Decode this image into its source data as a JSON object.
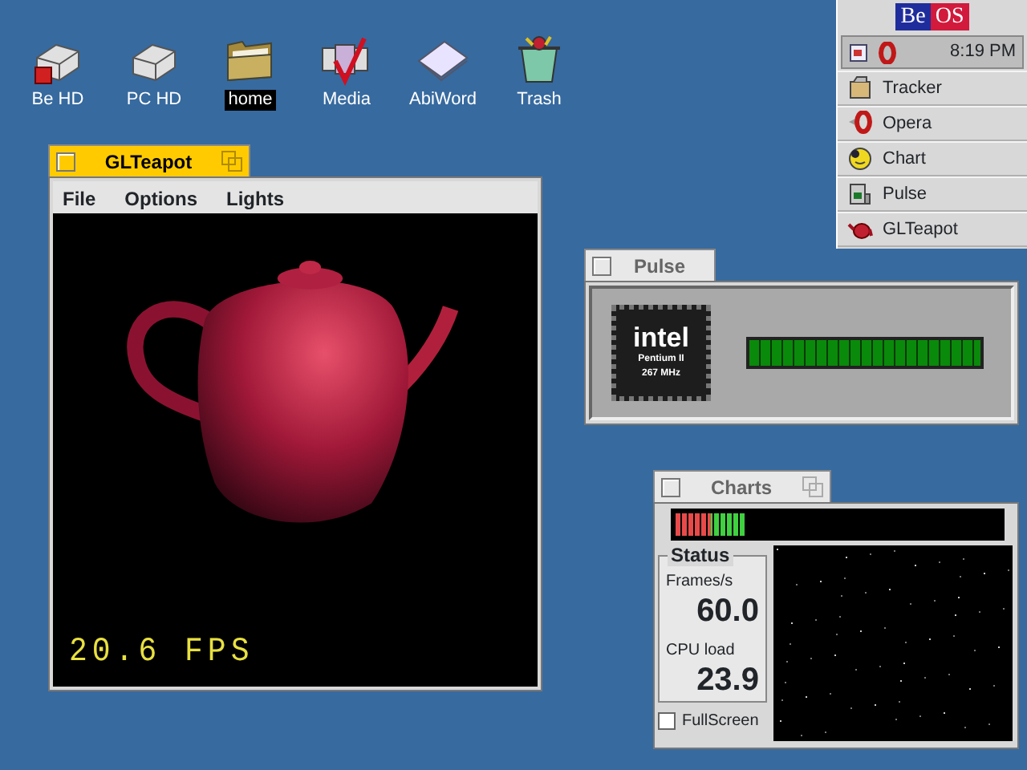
{
  "desktop_icons": [
    {
      "label": "Be HD",
      "kind": "boot-disk",
      "selected": false
    },
    {
      "label": "PC HD",
      "kind": "disk",
      "selected": false
    },
    {
      "label": "home",
      "kind": "folder",
      "selected": true
    },
    {
      "label": "Media",
      "kind": "media",
      "selected": false
    },
    {
      "label": "AbiWord",
      "kind": "document",
      "selected": false
    },
    {
      "label": "Trash",
      "kind": "trash",
      "selected": false
    }
  ],
  "deskbar": {
    "logo_left": "Be",
    "logo_right": "OS",
    "clock": "8:19 PM",
    "items": [
      {
        "label": "Tracker",
        "kind": "tracker"
      },
      {
        "label": "Opera",
        "kind": "opera"
      },
      {
        "label": "Chart",
        "kind": "chart"
      },
      {
        "label": "Pulse",
        "kind": "pulse"
      },
      {
        "label": "GLTeapot",
        "kind": "teapot"
      }
    ]
  },
  "glteapot_window": {
    "title": "GLTeapot",
    "active": true,
    "zoom_box": true,
    "menu": [
      "File",
      "Options",
      "Lights"
    ],
    "fps": "20.6 FPS"
  },
  "pulse_window": {
    "title": "Pulse",
    "active": false,
    "zoom_box": false,
    "chip": {
      "brand": "intel",
      "model": "Pentium II",
      "speed": "267 MHz"
    },
    "level": 1.0
  },
  "charts_window": {
    "title": "Charts",
    "active": false,
    "zoom_box": true,
    "level": 0.22,
    "status_title": "Status",
    "stats": [
      {
        "label": "Frames/s",
        "value": "60.0"
      },
      {
        "label": "CPU load",
        "value": "23.9"
      }
    ],
    "fullscreen": {
      "label": "FullScreen",
      "checked": false
    }
  }
}
